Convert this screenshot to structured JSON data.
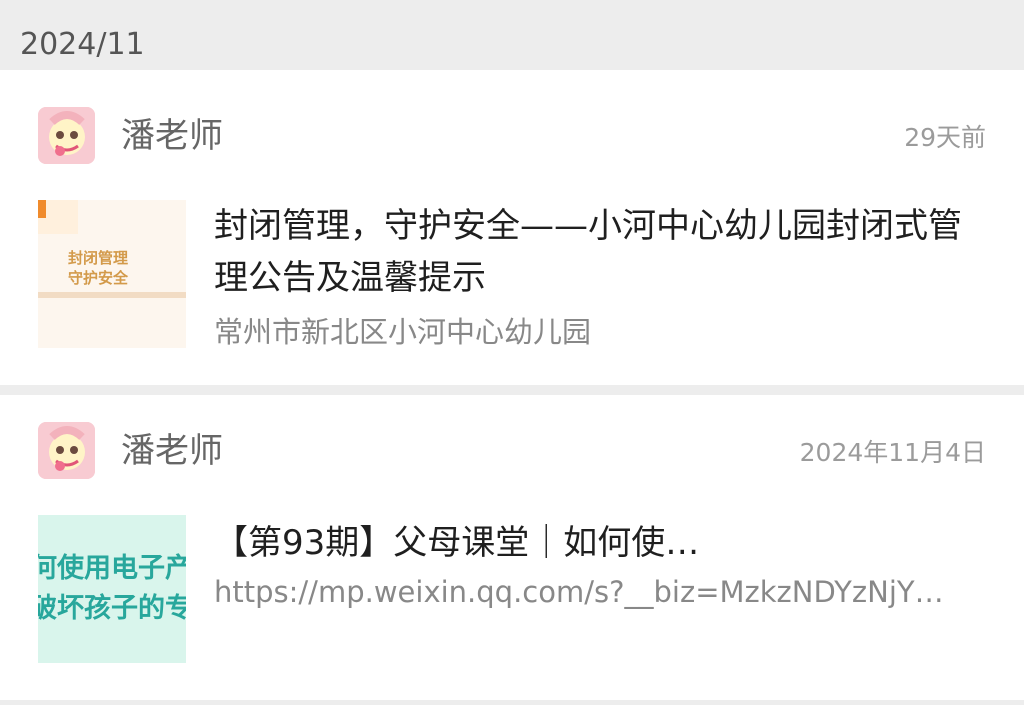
{
  "month_header": "2024/11",
  "items": [
    {
      "sender": "潘老师",
      "time": "29天前",
      "title": "封闭管理，守护安全——小河中心幼儿园封闭式管理公告及温馨提示",
      "source": "常州市新北区小河中心幼儿园",
      "thumbnail_text": "封闭管理\n守护安全"
    },
    {
      "sender": "潘老师",
      "time": "2024年11月4日",
      "title": "【第93期】父母课堂｜如何使…",
      "source": "https://mp.weixin.qq.com/s?__biz=MzkzNDYzNjY…",
      "thumbnail_text": "何使用电子产\n破坏孩子的专"
    }
  ],
  "colors": {
    "page_bg": "#ededed",
    "card_bg": "#ffffff",
    "title": "#1f1f1f",
    "secondary": "#888888",
    "avatar_pink": "#f9d3d8",
    "thumb1_orange": "#d39a4a",
    "thumb2_teal": "#28a79c"
  },
  "icons": {
    "avatar": "cartoon-avatar-icon",
    "thumbnail_1": "article-thumbnail",
    "thumbnail_2": "article-thumbnail"
  }
}
